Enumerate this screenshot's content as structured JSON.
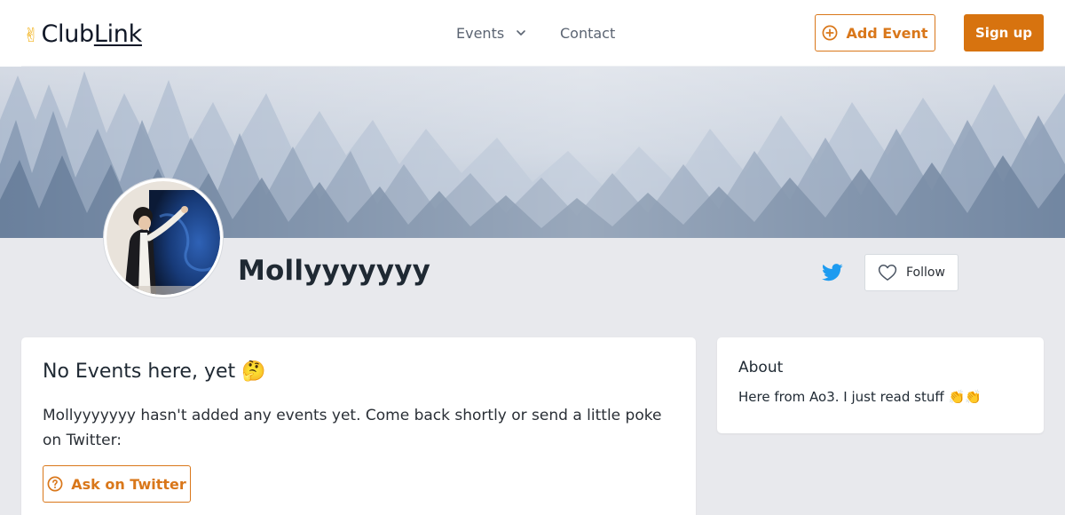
{
  "header": {
    "logo_emoji": "✌",
    "logo_club": "Club",
    "logo_link": "Link",
    "nav_events": "Events",
    "nav_contact": "Contact",
    "add_event": "Add Event",
    "sign_up": "Sign up"
  },
  "profile": {
    "name": "Mollyyyyyyy",
    "follow": "Follow"
  },
  "events": {
    "title": "No Events here, yet 🤔",
    "text": "Mollyyyyyyy hasn't added any events yet. Come back shortly or send a little poke on Twitter:",
    "ask_button": "Ask on Twitter"
  },
  "about": {
    "title": "About",
    "text": "Here from Ao3. I just read stuff 👏👏"
  },
  "colors": {
    "accent": "#d9771a",
    "twitter": "#1d9bf0",
    "background": "#e8e9ed"
  },
  "icons": {
    "events_dropdown": "chevron-down-icon",
    "add_event": "plus-circle-icon",
    "twitter": "twitter-icon",
    "follow": "heart-icon",
    "ask": "question-circle-icon"
  }
}
